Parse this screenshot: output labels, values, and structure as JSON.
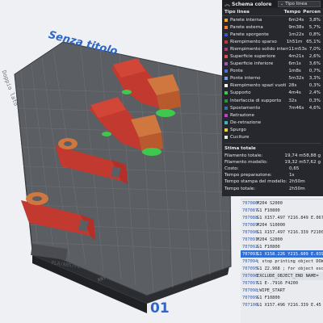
{
  "plate": {
    "title": "Senza titolo",
    "number": "01",
    "label_left": "PLA/ABS/PETG",
    "label_right": "ANYCUBIC",
    "side_label": "Doppio lato"
  },
  "legend": {
    "header_title": "Schema colore",
    "view_type": "Tipo linea",
    "columns": {
      "name": "Tipo linea",
      "time": "Tempo",
      "percent": "Percen"
    },
    "items": [
      {
        "name": "Parete interna",
        "time": "6m24s",
        "percent": "3,8%",
        "color": "#f6a23c"
      },
      {
        "name": "Parete esterna",
        "time": "9m38s",
        "percent": "5,7%",
        "color": "#f37b2d"
      },
      {
        "name": "Parete sporgente",
        "time": "1m22s",
        "percent": "0,8%",
        "color": "#3f52c9"
      },
      {
        "name": "Riempimento sparso",
        "time": "1h51m",
        "percent": "65,1%",
        "color": "#c0392b"
      },
      {
        "name": "Riempimento solido interno",
        "time": "11m53s",
        "percent": "7,0%",
        "color": "#b2387a"
      },
      {
        "name": "Superficie superiore",
        "time": "4m21s",
        "percent": "2,6%",
        "color": "#e34a4a"
      },
      {
        "name": "Superficie inferiore",
        "time": "6m1s",
        "percent": "3,6%",
        "color": "#9b59b6"
      },
      {
        "name": "Ponte",
        "time": "1m8s",
        "percent": "0,7%",
        "color": "#4a6fd8"
      },
      {
        "name": "Ponte interno",
        "time": "5m32s",
        "percent": "3,3%",
        "color": "#6fa6e8"
      },
      {
        "name": "Riempimento spazi vuoti",
        "time": "28s",
        "percent": "0,3%",
        "color": "#ffffff"
      },
      {
        "name": "Supporto",
        "time": "4m4s",
        "percent": "2,4%",
        "color": "#3cc84a"
      },
      {
        "name": "Interfaccia di supporto",
        "time": "32s",
        "percent": "0,3%",
        "color": "#2e8f3c"
      },
      {
        "name": "Spostamento",
        "time": "7m46s",
        "percent": "4,6%",
        "color": "#3a6ea5"
      },
      {
        "name": "Retrazione",
        "time": "",
        "percent": "",
        "color": "#c23dc2"
      },
      {
        "name": "De-retrazione",
        "time": "",
        "percent": "",
        "color": "#3fb4c9"
      },
      {
        "name": "Spurgo",
        "time": "",
        "percent": "",
        "color": "#e6d437"
      },
      {
        "name": "Cuciture",
        "time": "",
        "percent": "",
        "color": "#e8e8e8"
      }
    ]
  },
  "estimate": {
    "title": "Stima totale",
    "rows": [
      {
        "label": "Filamento totale:",
        "v1": "19,74 m",
        "v2": "58,88 g"
      },
      {
        "label": "Filamento modello:",
        "v1": "19,32 m",
        "v2": "57,62 g"
      },
      {
        "label": "Costo:",
        "v1": "0,65",
        "v2": ""
      },
      {
        "label": "Tempo preparazione:",
        "v1": "1s",
        "v2": ""
      },
      {
        "label": "Tempo stampa del modello:",
        "v1": "2h50m",
        "v2": ""
      },
      {
        "label": "Tempo totale:",
        "v1": "2h50m",
        "v2": ""
      }
    ]
  },
  "gcode": {
    "lines": [
      {
        "num": "707086",
        "text": "M204 S2000",
        "state": ""
      },
      {
        "num": "707087",
        "text": "G1 F10800",
        "state": ""
      },
      {
        "num": "707088",
        "text": "G1 X157.497 Y216.849 E.0675",
        "state": ""
      },
      {
        "num": "707089",
        "text": "M204 S10000",
        "state": ""
      },
      {
        "num": "707090",
        "text": "G1 X157.497 Y216.339 F2100",
        "state": ""
      },
      {
        "num": "707091",
        "text": "M204 S2000",
        "state": ""
      },
      {
        "num": "707092",
        "text": "G1 F10800",
        "state": ""
      },
      {
        "num": "707093",
        "text": "G1 X158.226 Y215.609 E.0391",
        "state": "sel"
      },
      {
        "num": "707094",
        "text": "; stop printing object DOWN",
        "state": ""
      },
      {
        "num": "707095",
        "text": "G1 Z2.968 ; for object exclus",
        "state": ""
      },
      {
        "num": "707096",
        "text": "EXCLUDE_OBJECT_END NAME=",
        "state": "c1"
      },
      {
        "num": "707097",
        "text": "G1 E-.7916 F4200",
        "state": ""
      },
      {
        "num": "707098",
        "text": ";WIPE_START",
        "state": ""
      },
      {
        "num": "707099",
        "text": "G1 F10800",
        "state": ""
      },
      {
        "num": "707100",
        "text": "G1 X157.496 Y216.339 E.45",
        "state": ""
      }
    ]
  }
}
